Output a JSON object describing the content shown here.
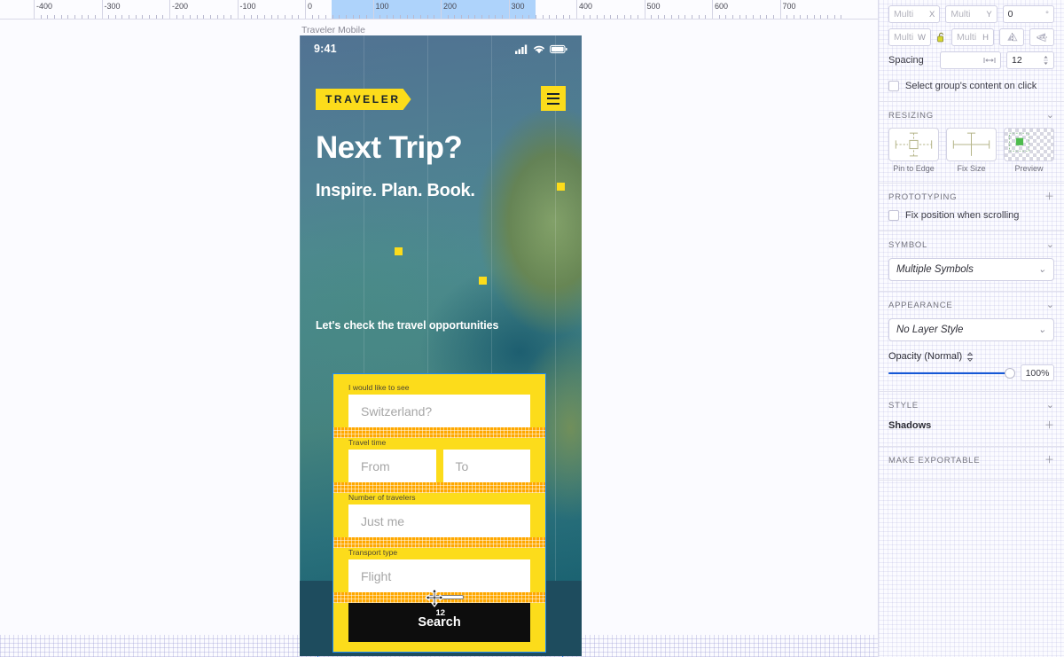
{
  "ruler": {
    "labels": [
      "-400",
      "-300",
      "-200",
      "-100",
      "0",
      "100",
      "200",
      "300",
      "400",
      "500",
      "600",
      "700"
    ],
    "selection_start": "0",
    "selection_end": "300"
  },
  "canvas": {
    "artboard_name": "Traveler Mobile"
  },
  "phone": {
    "status": {
      "time": "9:41",
      "signal_icon": "signal-bars-icon",
      "wifi_icon": "wifi-icon",
      "battery_icon": "battery-icon"
    },
    "logo": "TRAVELER",
    "menu_icon": "hamburger-menu-icon",
    "headline": "Next Trip?",
    "subheadline": "Inspire. Plan. Book.",
    "section_title": "Let's check the travel opportunities"
  },
  "form": {
    "fields": [
      {
        "label": "I would like to see",
        "placeholder": "Switzerland?"
      },
      {
        "label": "Travel time",
        "placeholder_from": "From",
        "placeholder_to": "To"
      },
      {
        "label": "Number of travelers",
        "placeholder": "Just me"
      },
      {
        "label": "Transport type",
        "placeholder": "Flight"
      }
    ],
    "submit_label": "Search",
    "spacing_badge": "12"
  },
  "inspector": {
    "transform": {
      "x_value": "Multi",
      "x_label": "X",
      "y_value": "Multi",
      "y_label": "Y",
      "rotation_value": "0",
      "rotation_unit": "°",
      "w_value": "Multi",
      "w_label": "W",
      "h_value": "Multi",
      "h_label": "H",
      "lock_icon": "lock-open-icon",
      "flip_horizontal_icon": "flip-horizontal-icon",
      "flip_vertical_icon": "flip-vertical-icon"
    },
    "spacing": {
      "label": "Spacing",
      "distribute_icon": "distribute-horizontal-icon",
      "value": "12",
      "stepper_icon": "stepper-icon"
    },
    "select_group_checkbox": {
      "label": "Select group's content on click",
      "checked": false
    },
    "resizing": {
      "title": "RESIZING",
      "chevron_icon": "chevron-down-icon",
      "options": [
        {
          "caption": "Pin to Edge",
          "icon": "pin-to-edge-icon"
        },
        {
          "caption": "Fix Size",
          "icon": "fix-size-icon"
        },
        {
          "caption": "Preview",
          "icon": "preview-icon"
        }
      ]
    },
    "prototyping": {
      "title": "PROTOTYPING",
      "plus_icon": "plus-icon",
      "fix_position_checkbox": {
        "label": "Fix position when scrolling",
        "checked": false
      }
    },
    "symbol": {
      "title": "SYMBOL",
      "chevron_icon": "chevron-down-icon",
      "value": "Multiple Symbols",
      "dropdown_icon": "chevron-down-icon"
    },
    "appearance": {
      "title": "APPEARANCE",
      "chevron_icon": "chevron-down-icon",
      "layer_style": "No Layer Style",
      "layer_style_dropdown_icon": "chevron-down-icon",
      "opacity_label": "Opacity (Normal)",
      "opacity_toggle_icon": "updown-chevrons-icon",
      "opacity_value": "100%"
    },
    "style": {
      "title": "STYLE",
      "chevron_icon": "chevron-down-icon",
      "shadows_label": "Shadows",
      "shadows_plus_icon": "plus-icon"
    },
    "make_exportable": {
      "title": "MAKE EXPORTABLE",
      "plus_icon": "plus-icon"
    }
  },
  "colors": {
    "accent_yellow": "#fcdc1b",
    "spacer_orange": "#ffa800",
    "guide_blue": "#2f86f7",
    "slider_blue": "#1558d6",
    "button_black": "#0d0d0d"
  }
}
